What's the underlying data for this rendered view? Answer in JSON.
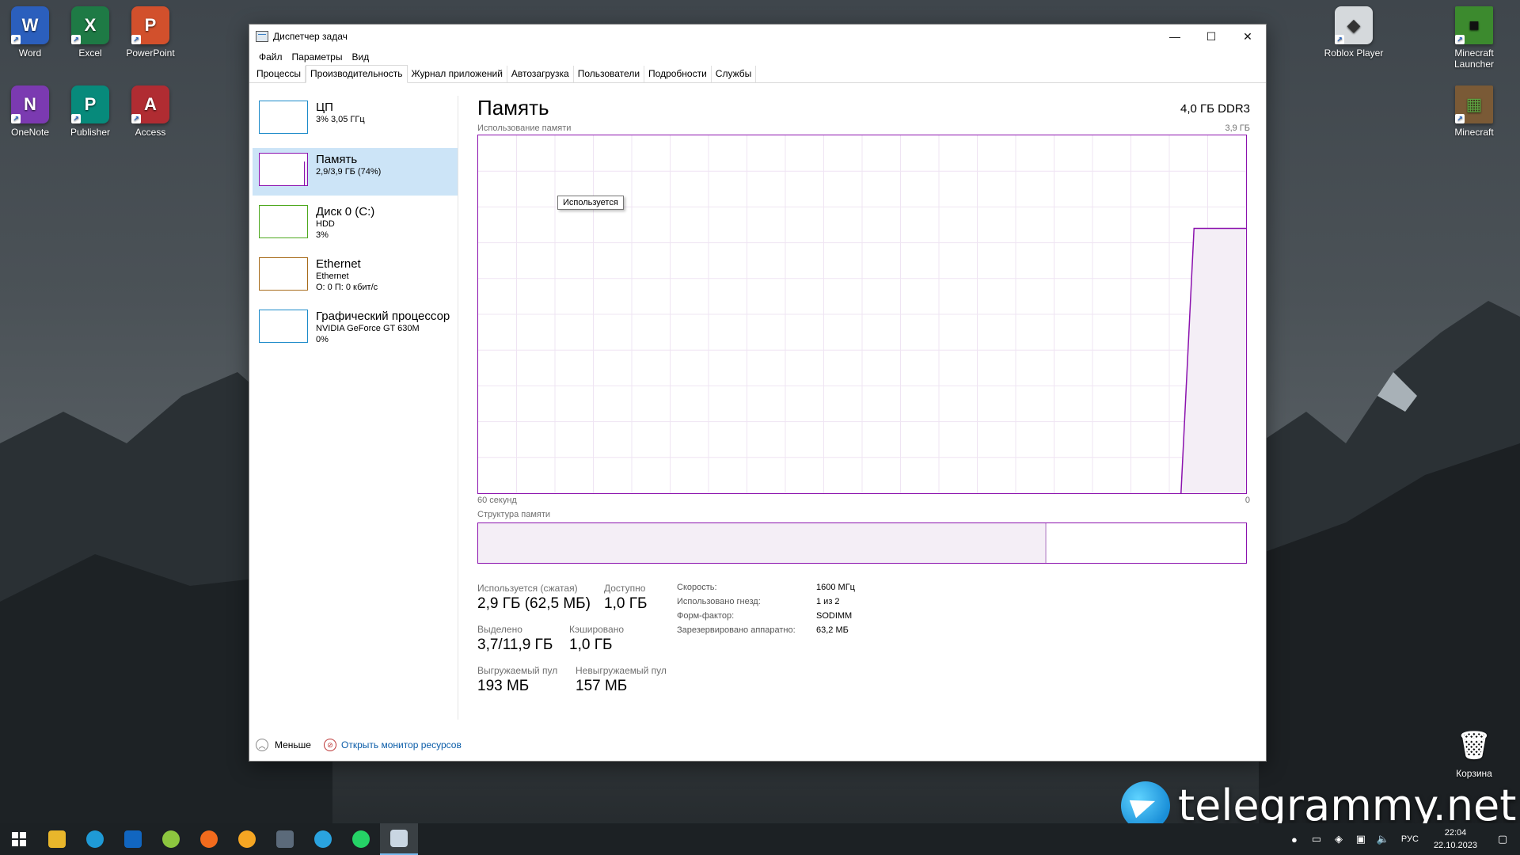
{
  "desktop": {
    "icons": [
      {
        "label": "Word",
        "glyph": "W",
        "color": "#2b5fbd"
      },
      {
        "label": "Excel",
        "glyph": "X",
        "color": "#1e7a45"
      },
      {
        "label": "PowerPoint",
        "glyph": "P",
        "color": "#d2502c"
      },
      {
        "label": "OneNote",
        "glyph": "N",
        "color": "#7b3ab1"
      },
      {
        "label": "Publisher",
        "glyph": "P",
        "color": "#078a7b"
      },
      {
        "label": "Access",
        "glyph": "A",
        "color": "#b02c32"
      },
      {
        "label": "Roblox Player",
        "glyph": "◆",
        "color": "#d5d9dc"
      },
      {
        "label": "Minecraft Launcher",
        "glyph": "■",
        "color": "#3c8a2e"
      },
      {
        "label": "Minecraft",
        "glyph": "▦",
        "color": "#7a5a36"
      },
      {
        "label": "Корзина",
        "glyph": "🗑",
        "color": "#cfd8e0"
      }
    ]
  },
  "window": {
    "title": "Диспетчер задач",
    "controls": {
      "minimize": "—",
      "maximize": "☐",
      "close": "✕"
    },
    "menu": [
      "Файл",
      "Параметры",
      "Вид"
    ],
    "tabs": [
      "Процессы",
      "Производительность",
      "Журнал приложений",
      "Автозагрузка",
      "Пользователи",
      "Подробности",
      "Службы"
    ],
    "active_tab": "Производительность"
  },
  "sidebar": {
    "items": [
      {
        "name": "ЦП",
        "line1": "3% 3,05 ГГц",
        "line2": "",
        "line3": "",
        "color": "#1c8ac9"
      },
      {
        "name": "Память",
        "line1": "2,9/3,9 ГБ (74%)",
        "line2": "",
        "line3": "",
        "color": "#8b12ae"
      },
      {
        "name": "Диск 0 (C:)",
        "line1": "HDD",
        "line2": "3%",
        "line3": "",
        "color": "#4da81e"
      },
      {
        "name": "Ethernet",
        "line1": "Ethernet",
        "line2": "О: 0 П: 0 кбит/с",
        "line3": "",
        "color": "#a76b1b"
      },
      {
        "name": "Графический процессор",
        "line1": "NVIDIA GeForce GT 630M",
        "line2": "0%",
        "line3": "",
        "color": "#1c8ac9"
      }
    ]
  },
  "main": {
    "title": "Память",
    "spec": "4,0 ГБ DDR3",
    "graph_label": "Использование памяти",
    "graph_max": "3,9 ГБ",
    "tooltip": "Используется",
    "axis_left": "60 секунд",
    "axis_right": "0",
    "composition_label": "Структура памяти",
    "composition_used_fraction": 0.74,
    "usage_series_fraction": [
      0,
      0,
      0,
      0,
      0,
      0,
      0,
      0,
      0,
      0,
      0,
      0,
      0,
      0,
      0,
      0,
      0,
      0,
      0,
      0,
      0,
      0,
      0,
      0,
      0,
      0,
      0,
      0,
      0,
      0,
      0,
      0,
      0,
      0,
      0,
      0,
      0,
      0,
      0,
      0,
      0,
      0,
      0,
      0,
      0,
      0,
      0,
      0,
      0,
      0,
      0,
      0,
      0,
      0,
      0,
      0.74,
      0.74,
      0.74,
      0.74,
      0.74
    ],
    "stats": [
      {
        "label": "Используется (сжатая)",
        "value": "2,9 ГБ (62,5 МБ)"
      },
      {
        "label": "Доступно",
        "value": "1,0 ГБ"
      },
      {
        "label": "Выделено",
        "value": "3,7/11,9 ГБ"
      },
      {
        "label": "Кэшировано",
        "value": "1,0 ГБ"
      },
      {
        "label": "Выгружаемый пул",
        "value": "193 МБ"
      },
      {
        "label": "Невыгружаемый пул",
        "value": "157 МБ"
      }
    ],
    "specs": [
      {
        "key": "Скорость:",
        "value": "1600 МГц"
      },
      {
        "key": "Использовано гнезд:",
        "value": "1 из 2"
      },
      {
        "key": "Форм-фактор:",
        "value": "SODIMM"
      },
      {
        "key": "Зарезервировано аппаратно:",
        "value": "63,2 МБ"
      }
    ],
    "accent": "#8b12ae"
  },
  "footer": {
    "less": "Меньше",
    "resource_monitor": "Открыть монитор ресурсов"
  },
  "taskbar": {
    "apps": [
      "start-icon",
      "file-explorer-icon",
      "edge-icon",
      "outlook-icon",
      "app-icon",
      "yandex-icon",
      "weather-icon",
      "calculator-icon",
      "telegram-icon",
      "whatsapp-icon",
      "task-manager-icon"
    ],
    "language": "РУС",
    "time": "22:04",
    "date": "22.10.2023"
  },
  "watermark": "telegrammy.net"
}
